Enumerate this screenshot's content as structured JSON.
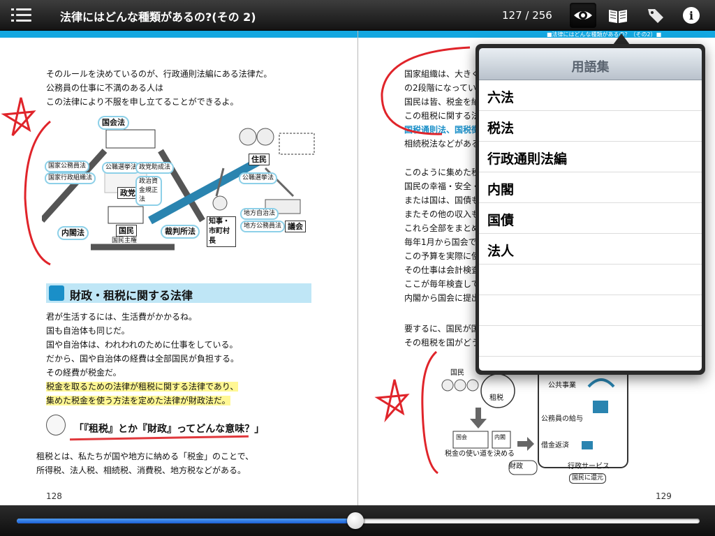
{
  "toolbar": {
    "title": "法律にはどんな種類があるの?(その 2)",
    "page_counter": "127 / 256",
    "buttons": {
      "menu": "menu-icon",
      "view": "eye-icon",
      "glossary": "book-icon",
      "tag": "tag-icon",
      "info": "info-icon"
    }
  },
  "left_page": {
    "intro_lines": [
      "そのルールを決めているのが、行政通則法編にある法律だ。",
      "公務員の仕事に不満のある人は",
      "この法律により不服を申し立てることができるよ。"
    ],
    "intro_highlight": "行政通則法",
    "diagram_labels": {
      "kokkai": "国会法",
      "kokumin": "国民",
      "kokumin_shuken": "国民主権",
      "seito": "政党",
      "naikaku": "内閣法",
      "saibansho": "裁判所法",
      "jumin": "住民",
      "chiji": "知事・市町村長",
      "gikai": "議会",
      "chiho_jichi": "地方自治法",
      "chiho_komuin": "地方公務員法",
      "komusen": "公職選挙法",
      "seiji_shikin": "政治資金規正法",
      "seito_joseiho": "政党助成法",
      "kokka_komuin": "国家公務員法",
      "kokka_gyosei": "国家行政組織法"
    },
    "section_title": "財政・租税に関する法律",
    "body_lines": [
      "君が生活するには、生活費がかかるね。",
      "国も自治体も同じだ。",
      "国や自治体は、われわれのために仕事をしている。",
      "だから、国や自治体の経費は全部国民が負担する。",
      "その経費が税金だ。",
      "税金を取るための法律が租税に関する法律であり、",
      "集めた税金を使う方法を定めた法律が財政法だ。"
    ],
    "question": "「『租税』とか『財政』ってどんな意味？」",
    "answer_lines": [
      "租税とは、私たちが国や地方に納める「税金」のことで、",
      "所得税、法人税、相続税、消費税、地方税などがある。"
    ],
    "page_number": "128"
  },
  "right_page": {
    "header_small": "■法律にはどんな種類があるの？（その2）■",
    "lines_top": [
      "国家組織は、大きく",
      "の2段階になってい",
      "国民は皆、税金を納",
      "この租税に関する法",
      "国税通則法、国税徴",
      "相続税法などがある"
    ],
    "lines_mid": [
      "このように集めた税",
      "国民の幸福・安全・",
      "または国は、国債も発",
      "またその他の収入も",
      "これら全部をまとめ",
      "毎年1月から国会で",
      "この予算を実際に使",
      "その仕事は会計検査",
      "ここが毎年検査して",
      "内閣から国会に提出"
    ],
    "lines_bottom": [
      "要するに、国民が国",
      "その租税を国がどう"
    ],
    "diagram_labels": {
      "kokumin": "国民",
      "sozei": "租税",
      "kokkai": "国会",
      "naikaku": "内閣",
      "decide": "税金の使い道を決める",
      "zaisei": "財政",
      "koukyou": "公共事業",
      "kyuyo": "公務員の給与",
      "saimu": "借金返済",
      "gyosei": "行政サービス",
      "kangen": "国民に還元"
    },
    "page_number": "129"
  },
  "glossary": {
    "title": "用語集",
    "items": [
      "六法",
      "税法",
      "行政通則法編",
      "内閣",
      "国債",
      "法人"
    ]
  },
  "slider": {
    "position": 0.496
  },
  "colors": {
    "accent_cyan": "#13a7e0",
    "ink_red": "#e0242a",
    "slider_blue": "#1b5fd6"
  }
}
